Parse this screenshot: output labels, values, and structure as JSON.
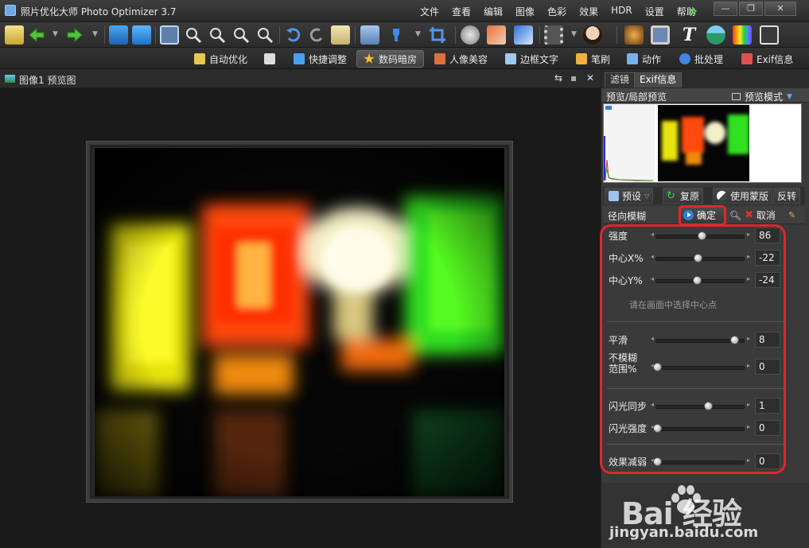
{
  "window": {
    "title": "照片优化大师 Photo Optimizer 3.7",
    "menu": [
      "文件",
      "查看",
      "编辑",
      "图像",
      "色彩",
      "效果",
      "HDR",
      "设置",
      "帮助"
    ],
    "controls": {
      "minimize": "—",
      "maximize": "❐",
      "close": "✕"
    }
  },
  "toolbar": {
    "icons": [
      "open-folder-icon",
      "back-arrow-icon",
      "forward-arrow-icon",
      "save-icon",
      "save-as-icon",
      "split-view-icon",
      "zoom-in-icon",
      "zoom-out-icon",
      "zoom-fit-icon",
      "zoom-actual-icon",
      "undo-icon",
      "redo-icon",
      "document-info-icon",
      "batch-icon",
      "crop-icon",
      "color-picker-icon",
      "brush-icon",
      "gradient-icon",
      "film-icon",
      "face-beauty-icon",
      "sparkle-icon",
      "frame-icon",
      "text-icon",
      "landscape-icon",
      "color-swatch-icon",
      "frame-stack-icon"
    ]
  },
  "ribbon": {
    "tabs": [
      {
        "label": "自动优化",
        "icon": "magic-wand-icon",
        "color": "#e8c650"
      },
      {
        "label": "",
        "icon": "tools-icon",
        "color": "#dcdcdc"
      },
      {
        "label": "快捷调整",
        "icon": "quick-adjust-icon",
        "color": "#4aa0f0"
      },
      {
        "label": "数码暗房",
        "icon": "star-icon",
        "color": "#f2c230",
        "active": true
      },
      {
        "label": "人像美容",
        "icon": "portrait-icon",
        "color": "#e07040"
      },
      {
        "label": "边框文字",
        "icon": "frame-text-icon",
        "color": "#a0c8f0"
      },
      {
        "label": "笔刷",
        "icon": "brush-icon",
        "color": "#f0b040"
      },
      {
        "label": "动作",
        "icon": "action-icon",
        "color": "#7ab0f0"
      },
      {
        "label": "批处理",
        "icon": "batch-play-icon",
        "color": "#3f86e6"
      },
      {
        "label": "Exif信息",
        "icon": "exif-icon",
        "color": "#e05050"
      }
    ]
  },
  "preview": {
    "title": "图像1 预览图",
    "controls": [
      "⇆",
      "▪",
      "✕"
    ]
  },
  "right_panel": {
    "tabs": [
      "滤镜",
      "Exif信息"
    ],
    "active_tab": "Exif信息",
    "subheader_left": "预览/局部预览",
    "subheader_right": "预览模式",
    "actions": {
      "preset": "预设",
      "restore": "复原",
      "use_mask": "使用蒙版",
      "invert": "反转"
    },
    "filter": {
      "name": "径向模糊",
      "ok": "确定",
      "cancel": "取消"
    },
    "params": [
      {
        "label": "强度",
        "value": "86",
        "pos": 0.5
      },
      {
        "label": "中心X%",
        "value": "-22",
        "pos": 0.46
      },
      {
        "label": "中心Y%",
        "value": "-24",
        "pos": 0.45
      },
      {
        "label": "平滑",
        "value": "8",
        "pos": 0.85
      },
      {
        "label": "不模糊\n范围%",
        "value": "0",
        "pos": 0.02
      },
      {
        "label": "闪光同步",
        "value": "1",
        "pos": 0.57
      },
      {
        "label": "闪光强度",
        "value": "0",
        "pos": 0.02
      },
      {
        "label": "效果减弱",
        "value": "0",
        "pos": 0.02
      }
    ],
    "hint": "请在画面中选择中心点"
  },
  "watermark": {
    "logo": "Bai  经验",
    "url": "jingyan.baidu.com"
  },
  "colors": {
    "highlight": "#e0262d",
    "accent_blue": "#2f7fe0"
  }
}
